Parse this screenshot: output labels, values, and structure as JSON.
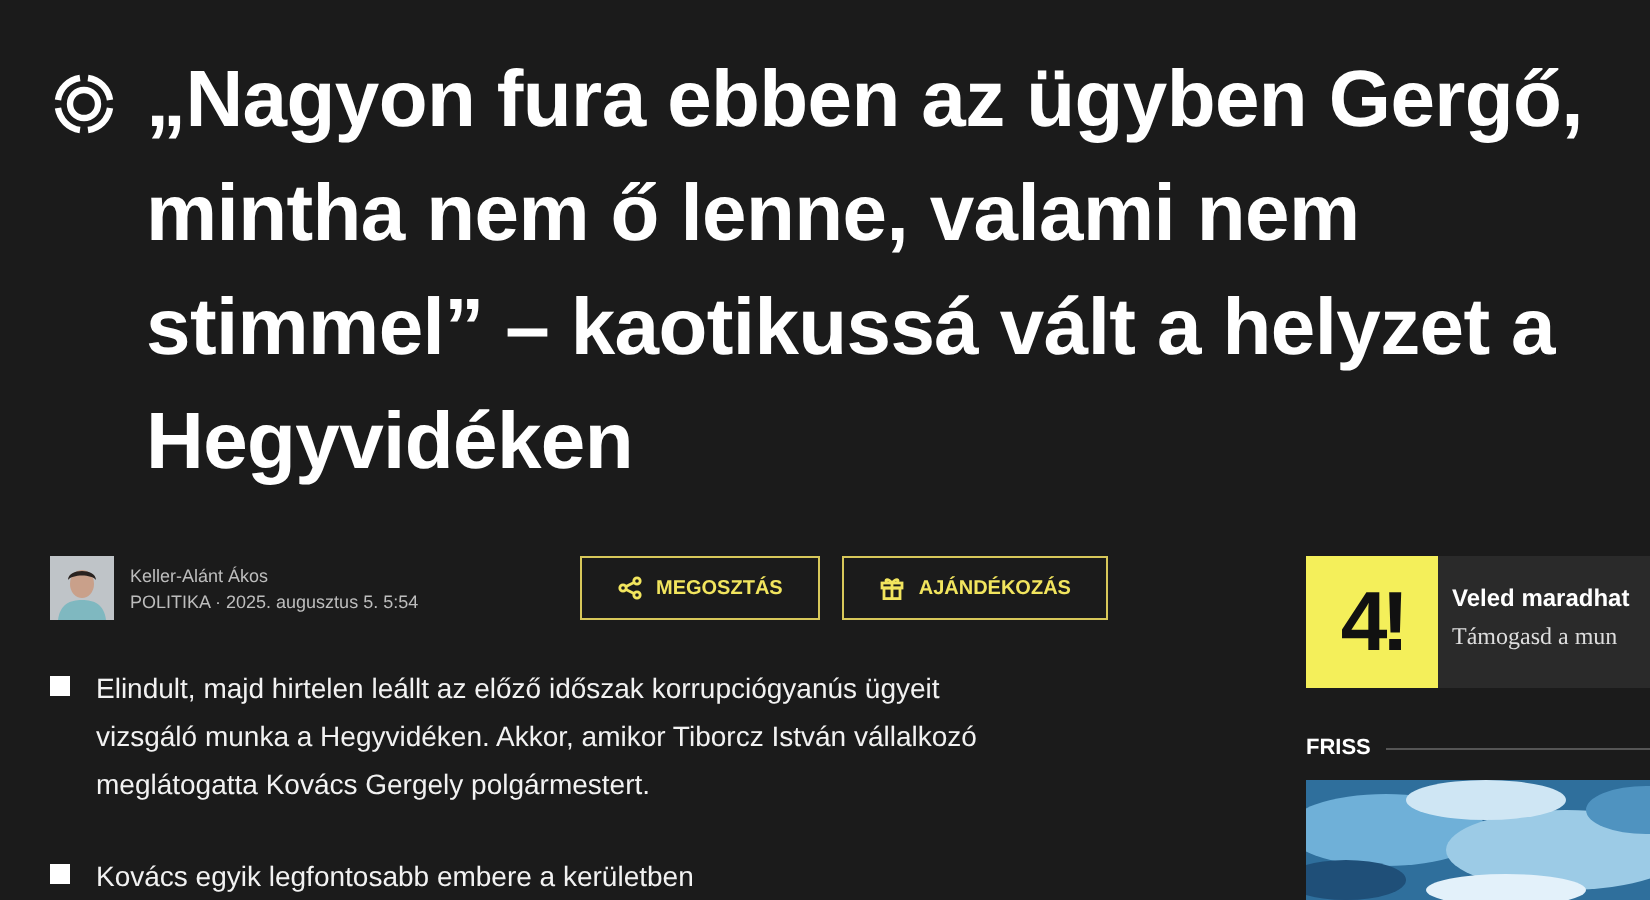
{
  "headline": {
    "text": "„Nagyon fura ebben az ügyben Gergő, mintha nem ő lenne, valami nem stimmel” – kaotikussá vált a helyzet a Hegyvidéken"
  },
  "byline": {
    "author": "Keller-Alánt Ákos",
    "meta": "POLITIKA · 2025. augusztus 5. 5:54"
  },
  "actions": [
    {
      "kind": "share",
      "label": "MEGOSZTÁS"
    },
    {
      "kind": "gift",
      "label": "AJÁNDÉKOZÁS"
    }
  ],
  "lead": [
    "Elindult, majd hirtelen leállt az előző időszak korrupciógyanús ügyeit vizsgáló munka a Hegyvidéken. Akkor, amikor Tiborcz István vállalkozó meglátogatta Kovács Gergely polgármestert.",
    "Kovács egyik legfontosabb embere a kerületben"
  ],
  "promo": {
    "logo": "4!",
    "title": "Veled maradhat",
    "subtitle": "Támogasd a mun"
  },
  "sidebar": {
    "heading": "FRISS"
  }
}
